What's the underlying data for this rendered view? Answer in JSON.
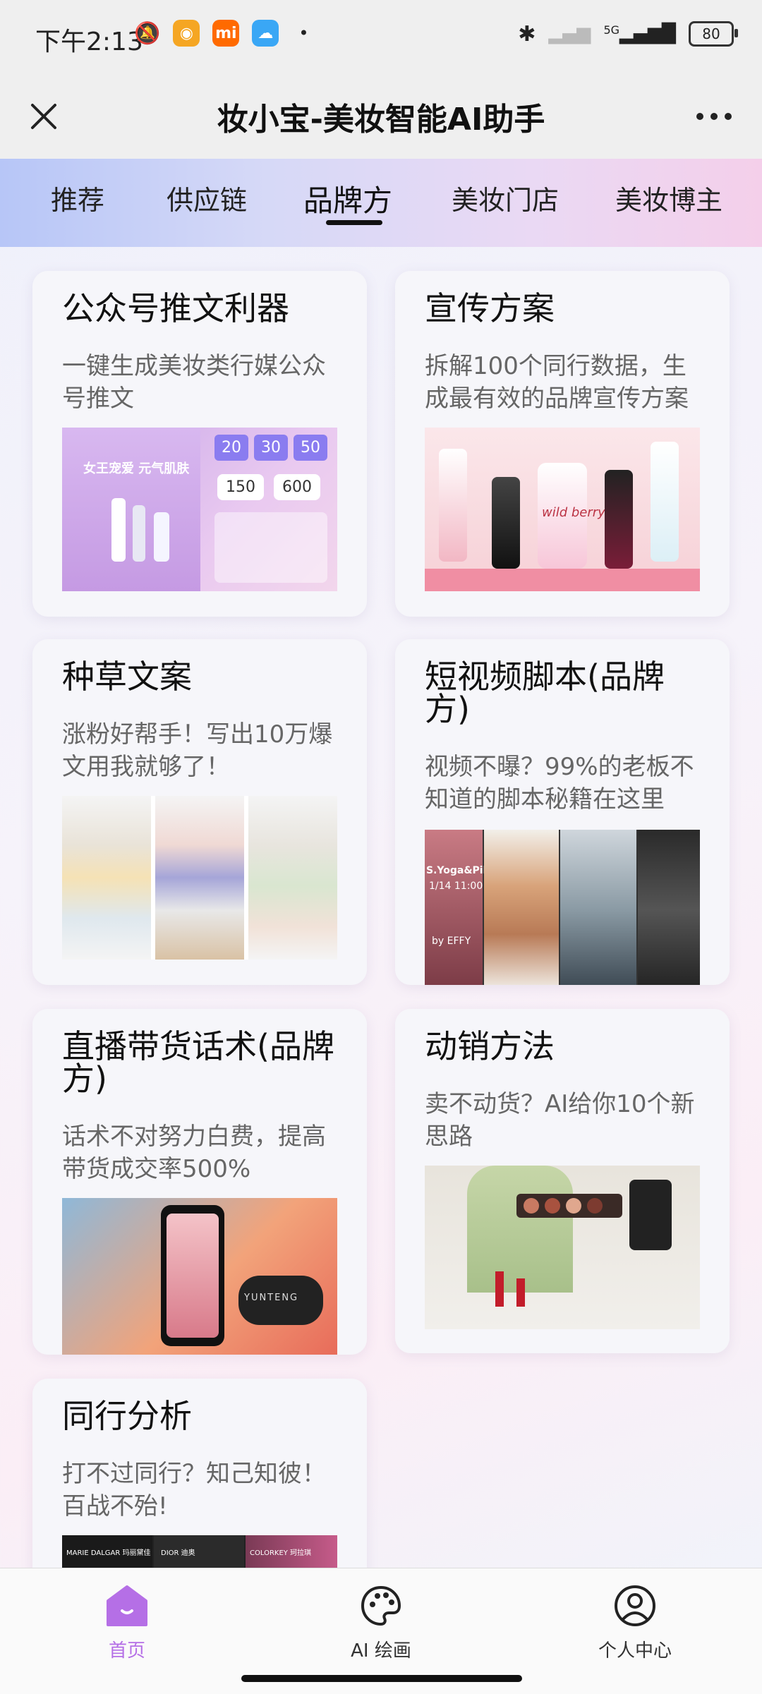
{
  "status_bar": {
    "time": "下午2:13",
    "network": "5G",
    "battery": "80"
  },
  "title_bar": {
    "title": "妆小宝-美妆智能AI助手"
  },
  "tabs": [
    {
      "label": "推荐"
    },
    {
      "label": "供应链"
    },
    {
      "label": "品牌方"
    },
    {
      "label": "美妆门店"
    },
    {
      "label": "美妆博主"
    }
  ],
  "active_tab": "品牌方",
  "cards": [
    {
      "title": "公众号推文利器",
      "desc": "一键生成美妆类行媒公众号推文"
    },
    {
      "title": "宣传方案",
      "desc": "拆解100个同行数据，生成最有效的品牌宣传方案"
    },
    {
      "title": "种草文案",
      "desc": "涨粉好帮手！写出10万爆文用我就够了！"
    },
    {
      "title": "短视频脚本(品牌方)",
      "desc": "视频不曝？99%的老板不知道的脚本秘籍在这里"
    },
    {
      "title": "直播带货话术(品牌方)",
      "desc": "话术不对努力白费，提高带货成交率500%"
    },
    {
      "title": "动销方法",
      "desc": "卖不动货？AI给你10个新思路"
    },
    {
      "title": "同行分析",
      "desc": "打不过同行？知己知彼！百战不殆!"
    }
  ],
  "thumb_text": {
    "poster_headline": "女王宠爱 元气肌肤",
    "price_a": "150",
    "price_b": "600",
    "coupon_a": "20",
    "coupon_b": "30",
    "coupon_c": "50",
    "bottle_label": "wild berry",
    "yoga_caption": "S.Yoga&Pilates",
    "yoga_date": "1/14 11:00",
    "yoga_by": "by EFFY",
    "stand_brand": "YUNTENG",
    "peer_a": "MARIE DALGAR 玛丽黛佳",
    "peer_b": "DIOR 迪奥",
    "peer_c": "COLORKEY 珂拉琪"
  },
  "bottom_nav": [
    {
      "label": "首页",
      "active": true
    },
    {
      "label": "AI 绘画",
      "active": false
    },
    {
      "label": "个人中心",
      "active": false
    }
  ],
  "colors": {
    "accent": "#b56fe6",
    "text": "#111111",
    "desc": "#666666"
  }
}
